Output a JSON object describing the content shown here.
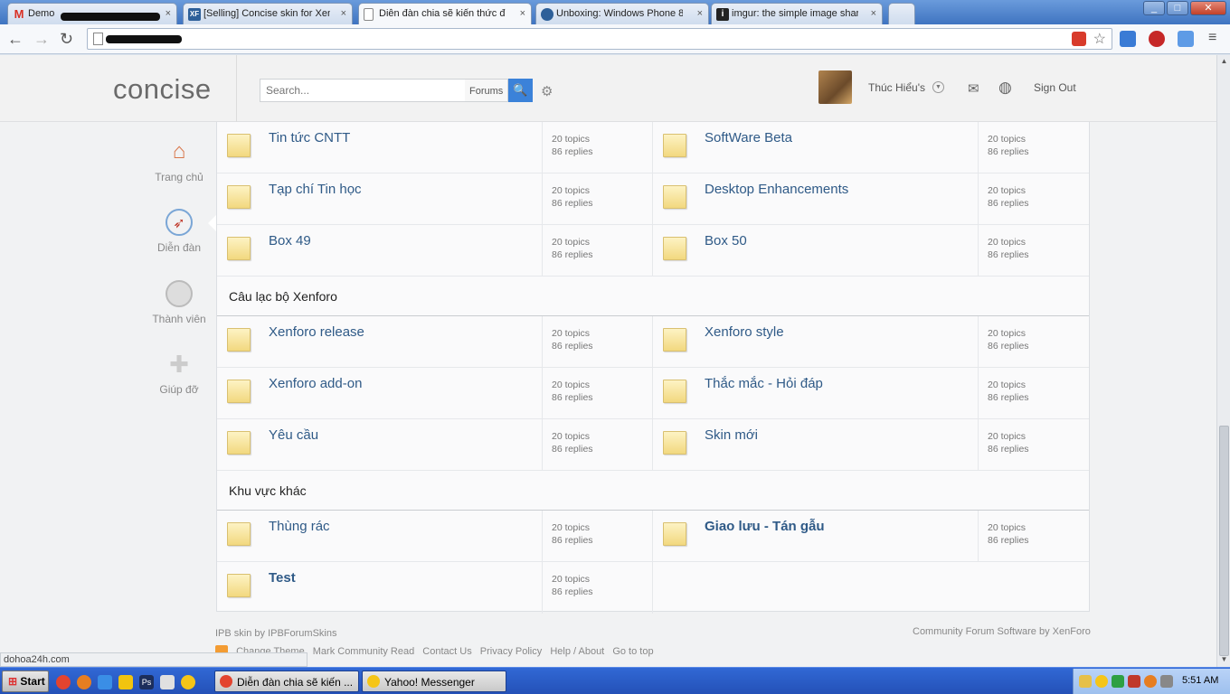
{
  "browser": {
    "tabs": [
      {
        "label": "Demo",
        "favicon": "M",
        "favicon_color": "#d93025"
      },
      {
        "label": "[Selling] Concise skin for Xen",
        "favicon": "XF",
        "favicon_color": "#2d5f99"
      },
      {
        "label": "Diễn đàn chia sẽ kiến thức đồ",
        "favicon": "",
        "favicon_color": "#ffffff"
      },
      {
        "label": "Unboxing: Windows Phone 8",
        "favicon": "",
        "favicon_color": "#2d5f99"
      },
      {
        "label": "imgur: the simple image shar",
        "favicon": "i",
        "favicon_color": "#222222"
      }
    ],
    "close_glyph": "×"
  },
  "site": {
    "logo": "concise",
    "search_placeholder": "Search...",
    "search_scope": "Forums",
    "username": "Thúc Hiểu's",
    "sign_out": "Sign Out"
  },
  "sidebar": [
    {
      "label": "Trang chủ",
      "icon": "home-icon"
    },
    {
      "label": "Diễn đàn",
      "icon": "compass-icon"
    },
    {
      "label": "Thành viên",
      "icon": "member-icon"
    },
    {
      "label": "Giúp đỡ",
      "icon": "help-icon"
    }
  ],
  "forums": {
    "rows": [
      {
        "left": {
          "title": "Tin tức CNTT",
          "topics": "20 topics",
          "replies": "86 replies"
        },
        "right": {
          "title": "SoftWare Beta",
          "topics": "20 topics",
          "replies": "86 replies"
        }
      },
      {
        "left": {
          "title": "Tạp chí Tin học",
          "topics": "20 topics",
          "replies": "86 replies"
        },
        "right": {
          "title": "Desktop Enhancements",
          "topics": "20 topics",
          "replies": "86 replies"
        }
      },
      {
        "left": {
          "title": "Box 49",
          "topics": "20 topics",
          "replies": "86 replies"
        },
        "right": {
          "title": "Box 50",
          "topics": "20 topics",
          "replies": "86 replies"
        }
      }
    ],
    "cat1": {
      "title": "Câu lạc bộ Xenforo",
      "rows": [
        {
          "left": {
            "title": "Xenforo release",
            "topics": "20 topics",
            "replies": "86 replies"
          },
          "right": {
            "title": "Xenforo style",
            "topics": "20 topics",
            "replies": "86 replies"
          }
        },
        {
          "left": {
            "title": "Xenforo add-on",
            "topics": "20 topics",
            "replies": "86 replies"
          },
          "right": {
            "title": "Thắc mắc - Hỏi đáp",
            "topics": "20 topics",
            "replies": "86 replies"
          }
        },
        {
          "left": {
            "title": "Yêu cầu",
            "topics": "20 topics",
            "replies": "86 replies"
          },
          "right": {
            "title": "Skin mới",
            "topics": "20 topics",
            "replies": "86 replies"
          }
        }
      ]
    },
    "cat2": {
      "title": "Khu vực khác",
      "rows": [
        {
          "left": {
            "title": "Thùng rác",
            "topics": "20 topics",
            "replies": "86 replies"
          },
          "right": {
            "title": "Giao lưu - Tán gẫu",
            "topics": "20 topics",
            "replies": "86 replies"
          }
        },
        {
          "left": {
            "title": "Test",
            "topics": "20 topics",
            "replies": "86 replies"
          }
        }
      ]
    }
  },
  "footer": {
    "left": "IPB skin by IPBForumSkins",
    "right": "Community Forum Software by XenForo",
    "links": [
      "Change Theme",
      "Mark Community Read",
      "Contact Us",
      "Privacy Policy",
      "Help / About",
      "Go to top"
    ]
  },
  "statusbar": "dohoa24h.com",
  "taskbar": {
    "start": "Start",
    "tasks": [
      "Diễn đàn chia sẽ kiến ...",
      "Yahoo! Messenger"
    ],
    "clock": "5:51 AM"
  }
}
